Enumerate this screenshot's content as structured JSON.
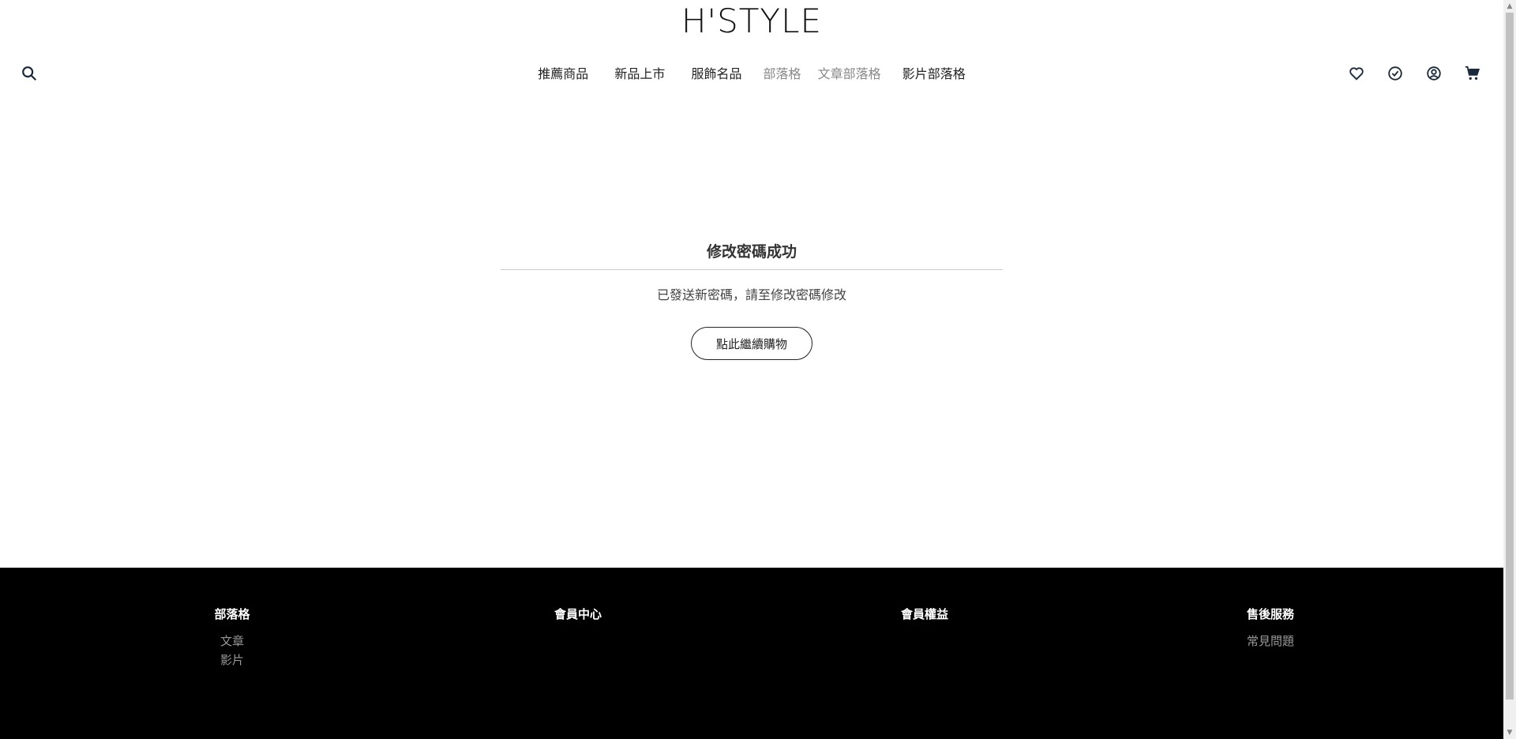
{
  "header": {
    "logo": "H'STYLE",
    "nav": [
      {
        "label": "推薦商品"
      },
      {
        "label": "新品上市"
      },
      {
        "label": "服飾名品"
      },
      {
        "label": "部落格"
      },
      {
        "label": "文章部落格"
      },
      {
        "label": "影片部落格"
      }
    ],
    "icons": [
      "search-icon",
      "heart-icon",
      "check-circle-icon",
      "user-icon",
      "cart-icon"
    ]
  },
  "main": {
    "title": "修改密碼成功",
    "message": "已發送新密碼，請至修改密碼修改",
    "button": "點此繼續購物"
  },
  "footer": {
    "columns": [
      {
        "title": "部落格",
        "links": [
          "文章",
          "影片"
        ]
      },
      {
        "title": "會員中心",
        "links": []
      },
      {
        "title": "會員權益",
        "links": []
      },
      {
        "title": "售後服務",
        "links": [
          "常見問題"
        ]
      }
    ]
  },
  "colors": {
    "footer_bg": "#000000",
    "muted_text": "#888888"
  }
}
